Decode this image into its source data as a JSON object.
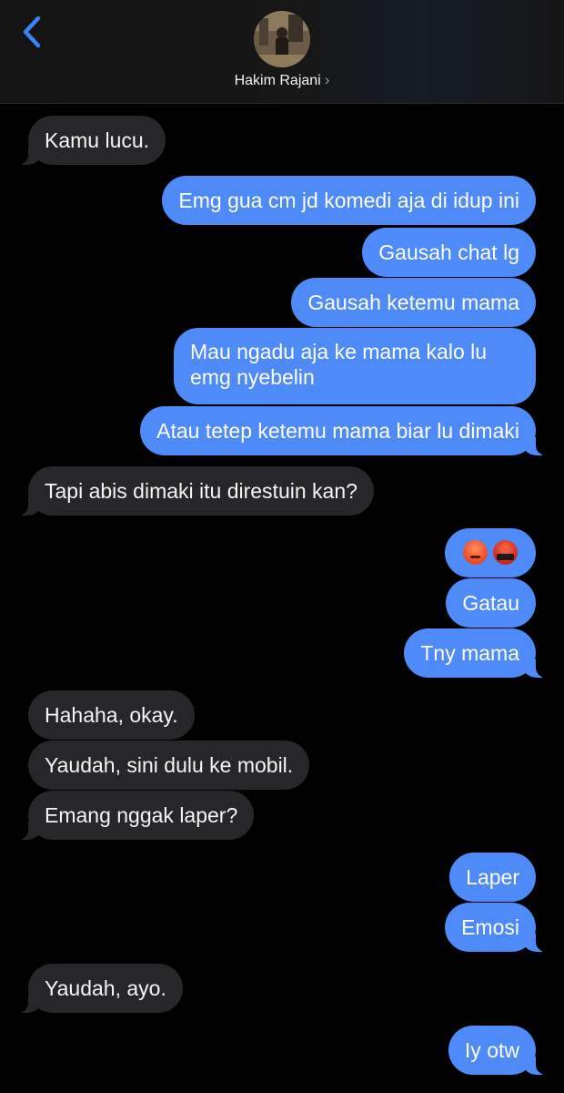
{
  "header": {
    "contact_name": "Hakim Rajani",
    "chevron": "›",
    "back_icon": "chevron-left-icon",
    "accent_color": "#3b82f6"
  },
  "colors": {
    "incoming_bubble": "#27272a",
    "outgoing_bubble": "#4f8bf8",
    "background": "#000000"
  },
  "messages": [
    {
      "from": "contact",
      "text": "Kamu lucu."
    },
    {
      "from": "me",
      "text": "Emg gua cm jd komedi aja di idup ini"
    },
    {
      "from": "me",
      "text": "Gausah chat lg"
    },
    {
      "from": "me",
      "text": "Gausah ketemu mama"
    },
    {
      "from": "me",
      "text": "Mau ngadu aja ke mama kalo lu emg nyebelin"
    },
    {
      "from": "me",
      "text": "Atau tetep ketemu mama biar lu dimaki"
    },
    {
      "from": "contact",
      "text": "Tapi abis dimaki itu direstuin kan?"
    },
    {
      "from": "me",
      "text": "",
      "emoji": [
        "angry-face",
        "face-with-symbols-on-mouth"
      ]
    },
    {
      "from": "me",
      "text": "Gatau"
    },
    {
      "from": "me",
      "text": "Tny mama"
    },
    {
      "from": "contact",
      "text": "Hahaha, okay."
    },
    {
      "from": "contact",
      "text": "Yaudah, sini dulu ke mobil."
    },
    {
      "from": "contact",
      "text": "Emang nggak laper?"
    },
    {
      "from": "me",
      "text": "Laper"
    },
    {
      "from": "me",
      "text": "Emosi"
    },
    {
      "from": "contact",
      "text": "Yaudah, ayo."
    },
    {
      "from": "me",
      "text": "Iy otw"
    }
  ]
}
